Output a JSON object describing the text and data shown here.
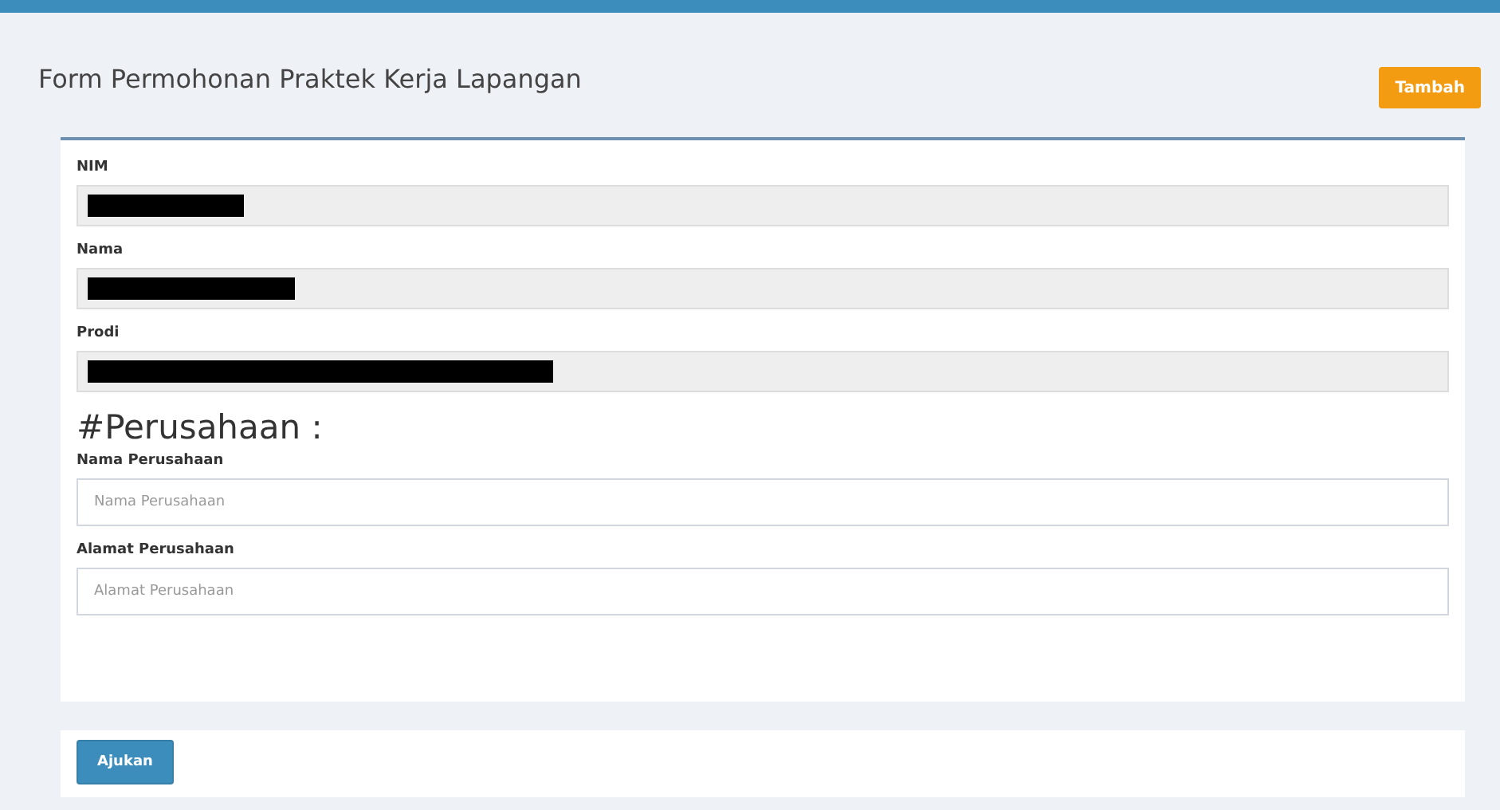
{
  "page": {
    "title": "Form Permohonan Praktek Kerja Lapangan",
    "action_button": "Tambah"
  },
  "student_fields": [
    {
      "label": "NIM",
      "redacted": true
    },
    {
      "label": "Nama",
      "redacted": true
    },
    {
      "label": "Prodi",
      "redacted": true
    }
  ],
  "company_heading": "#Perusahaan :",
  "company_fields": [
    {
      "label": "Nama Perusahaan",
      "placeholder": "Nama Perusahaan"
    },
    {
      "label": "Alamat Perusahaan",
      "placeholder": "Alamat Perusahaan"
    }
  ],
  "submit_button": "Ajukan"
}
